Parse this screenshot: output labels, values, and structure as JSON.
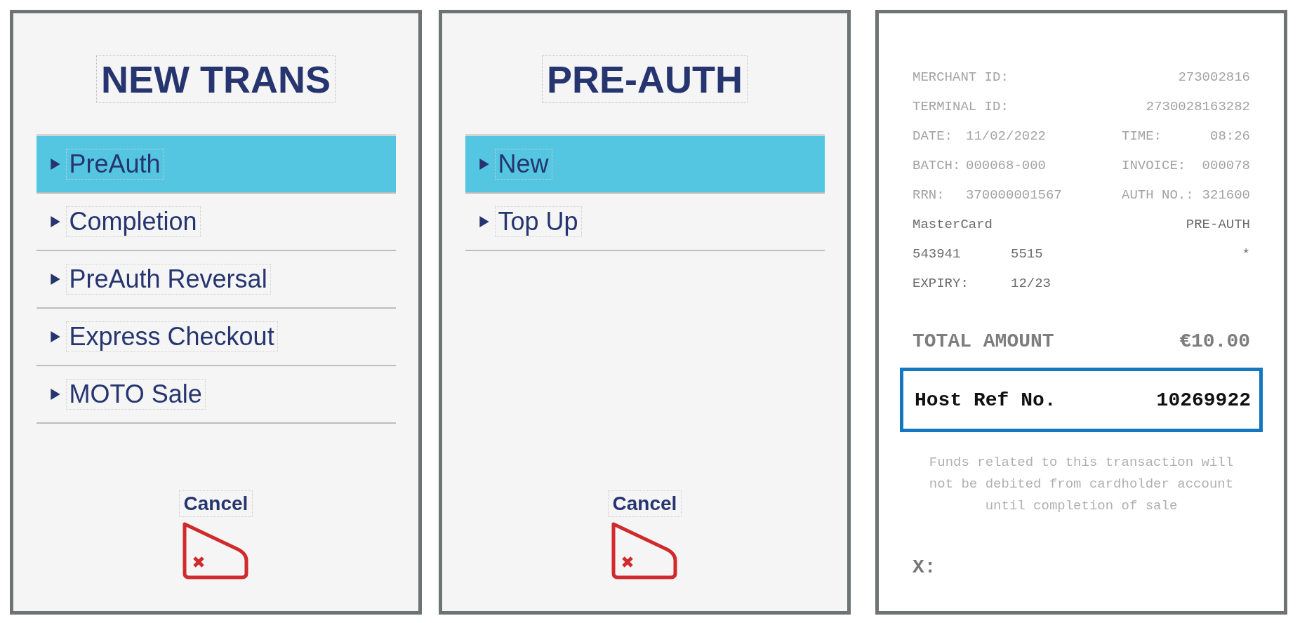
{
  "panels": [
    {
      "kind": "menu",
      "title": "NEW TRANS",
      "items": [
        {
          "label": "PreAuth",
          "selected": true
        },
        {
          "label": "Completion",
          "selected": false
        },
        {
          "label": "PreAuth Reversal",
          "selected": false
        },
        {
          "label": "Express Checkout",
          "selected": false
        },
        {
          "label": "MOTO Sale",
          "selected": false
        }
      ],
      "cancel": "Cancel"
    },
    {
      "kind": "menu",
      "title": "PRE-AUTH",
      "items": [
        {
          "label": "New",
          "selected": true
        },
        {
          "label": "Top Up",
          "selected": false
        }
      ],
      "cancel": "Cancel"
    },
    {
      "kind": "receipt",
      "lines": [
        {
          "kind": "info",
          "label": "MERCHANT ID:",
          "value2": "273002816"
        },
        {
          "kind": "info",
          "label": "TERMINAL ID:",
          "value2": "2730028163282"
        },
        {
          "kind": "info",
          "label": "DATE:",
          "value": "11/02/2022",
          "label2": "TIME:",
          "value2": "08:26"
        },
        {
          "kind": "info",
          "label": "BATCH:",
          "value": "000068-000",
          "label2": "INVOICE:",
          "value2": "000078"
        },
        {
          "kind": "info",
          "label": "RRN:",
          "value": "370000001567",
          "label2": "AUTH NO.:",
          "value2": "321600"
        },
        {
          "kind": "card",
          "label": "MasterCard",
          "value2": "PRE-AUTH"
        },
        {
          "kind": "card",
          "label": "543941",
          "value": "5515",
          "value2": "*"
        },
        {
          "kind": "card",
          "label": "EXPIRY:",
          "value": "12/23"
        }
      ],
      "total": {
        "label": "TOTAL AMOUNT",
        "value": "€10.00"
      },
      "host_ref": {
        "label": "Host Ref No.",
        "value": "10269922"
      },
      "note": "Funds related to this transaction will not be debited from cardholder account until completion of sale",
      "signature": "X:"
    }
  ]
}
